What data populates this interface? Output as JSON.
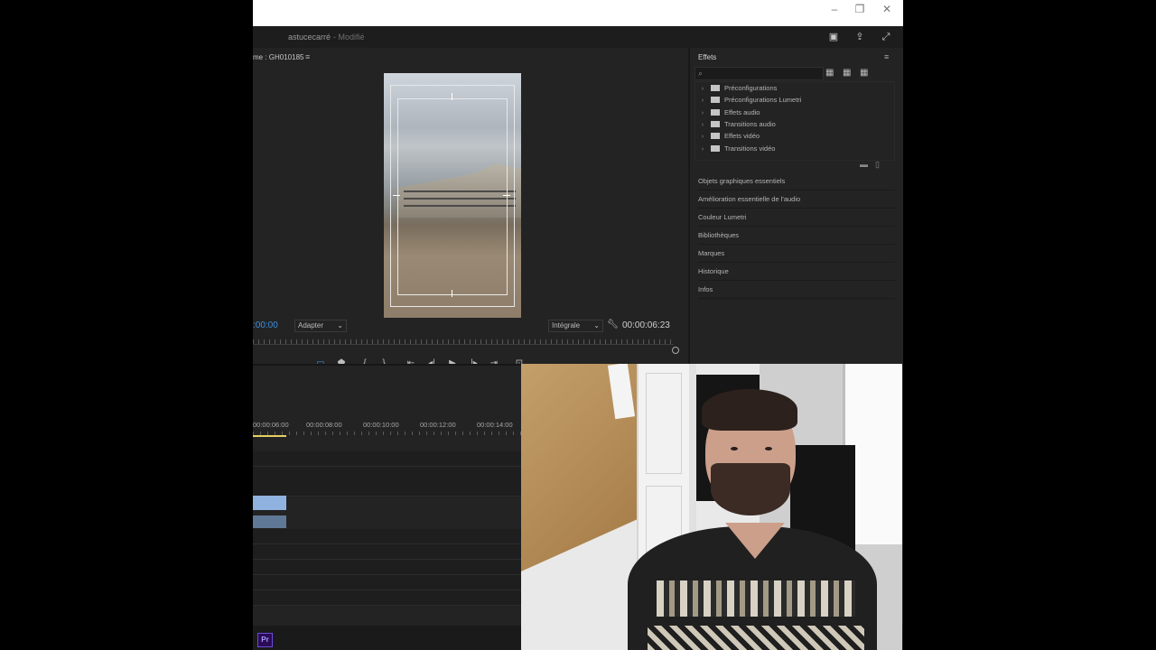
{
  "window": {
    "minimize_icon": "minimize-icon",
    "restore_icon": "restore-icon",
    "close_icon": "close-icon"
  },
  "appbar": {
    "project_name": "astucecarré",
    "status": "- Modifié"
  },
  "program_monitor": {
    "label": "me : GH010185",
    "menu_glyph": "≡",
    "timecode_current": ":00:00",
    "fit_select": "Adapter",
    "resolution_select": "Intégrale",
    "timecode_duration": "00:00:06:23"
  },
  "effects_panel": {
    "title": "Effets",
    "menu_glyph": "≡",
    "search_placeholder": "",
    "tree": [
      {
        "label": "Préconfigurations"
      },
      {
        "label": "Préconfigurations Lumetri"
      },
      {
        "label": "Effets audio"
      },
      {
        "label": "Transitions audio"
      },
      {
        "label": "Effets vidéo"
      },
      {
        "label": "Transitions vidéo"
      }
    ],
    "sections": [
      "Objets graphiques essentiels",
      "Amélioration essentielle de l'audio",
      "Couleur Lumetri",
      "Bibliothèques",
      "Marques",
      "Historique",
      "Infos"
    ]
  },
  "timeline": {
    "ruler_labels": [
      "00:00:06:00",
      "00:00:08:00",
      "00:00:10:00",
      "00:00:12:00",
      "00:00:14:00"
    ]
  },
  "taskbar": {
    "app_badge": "Pr"
  },
  "colors": {
    "accent": "#3a8fe0",
    "playhead": "#e6cf62",
    "clip_video": "#8fb2e0",
    "clip_audio": "#5f7896",
    "panel_bg": "#232323"
  }
}
